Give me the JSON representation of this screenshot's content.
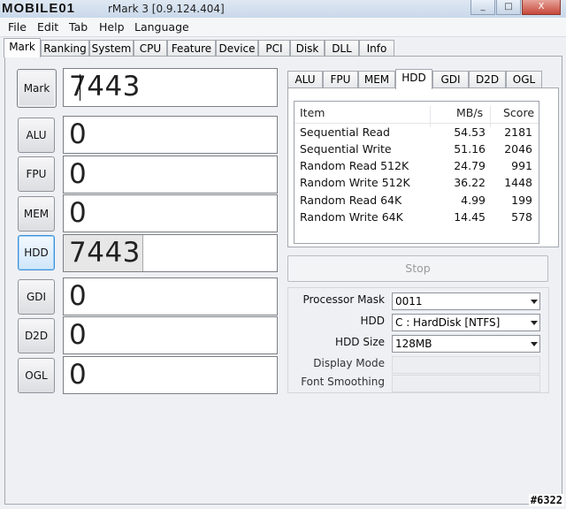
{
  "window": {
    "logo_text": "MOBILE01",
    "title": "rMark 3 [0.9.124.404]",
    "buttons": {
      "minimize": "_",
      "maximize": "□",
      "close": "X"
    }
  },
  "menu": [
    "File",
    "Edit",
    "Tab",
    "Help",
    "Language"
  ],
  "main_tabs": [
    "Mark",
    "Ranking",
    "System",
    "CPU",
    "Feature",
    "Device",
    "PCI",
    "Disk",
    "DLL",
    "Info"
  ],
  "main_tab_active": "Mark",
  "scores": [
    {
      "label": "Mark",
      "value": "7443",
      "fill": 0.0
    },
    {
      "label": "ALU",
      "value": "0",
      "fill": 0.0
    },
    {
      "label": "FPU",
      "value": "0",
      "fill": 0.0
    },
    {
      "label": "MEM",
      "value": "0",
      "fill": 0.0
    },
    {
      "label": "HDD",
      "value": "7443",
      "fill": 0.37
    },
    {
      "label": "GDI",
      "value": "0",
      "fill": 0.0
    },
    {
      "label": "D2D",
      "value": "0",
      "fill": 0.0
    },
    {
      "label": "OGL",
      "value": "0",
      "fill": 0.0
    }
  ],
  "sub_tabs": [
    "ALU",
    "FPU",
    "MEM",
    "HDD",
    "GDI",
    "D2D",
    "OGL"
  ],
  "sub_tab_active": "HDD",
  "results": {
    "headers": [
      "Item",
      "MB/s",
      "Score"
    ],
    "rows": [
      [
        "Sequential Read",
        "54.53",
        "2181"
      ],
      [
        "Sequential Write",
        "51.16",
        "2046"
      ],
      [
        "Random Read 512K",
        "24.79",
        "991"
      ],
      [
        "Random Write 512K",
        "36.22",
        "1448"
      ],
      [
        "Random Read 64K",
        "4.99",
        "199"
      ],
      [
        "Random Write 64K",
        "14.45",
        "578"
      ]
    ]
  },
  "stop_label": "Stop",
  "options": {
    "processor_mask": {
      "label": "Processor Mask",
      "value": "0011"
    },
    "hdd": {
      "label": "HDD",
      "value": "C : HardDisk [NTFS]"
    },
    "hdd_size": {
      "label": "HDD Size",
      "value": "128MB"
    },
    "display_mode": {
      "label": "Display Mode",
      "value": ""
    },
    "font_smoothing": {
      "label": "Font Smoothing",
      "value": ""
    }
  },
  "corner_badge": "#6322"
}
